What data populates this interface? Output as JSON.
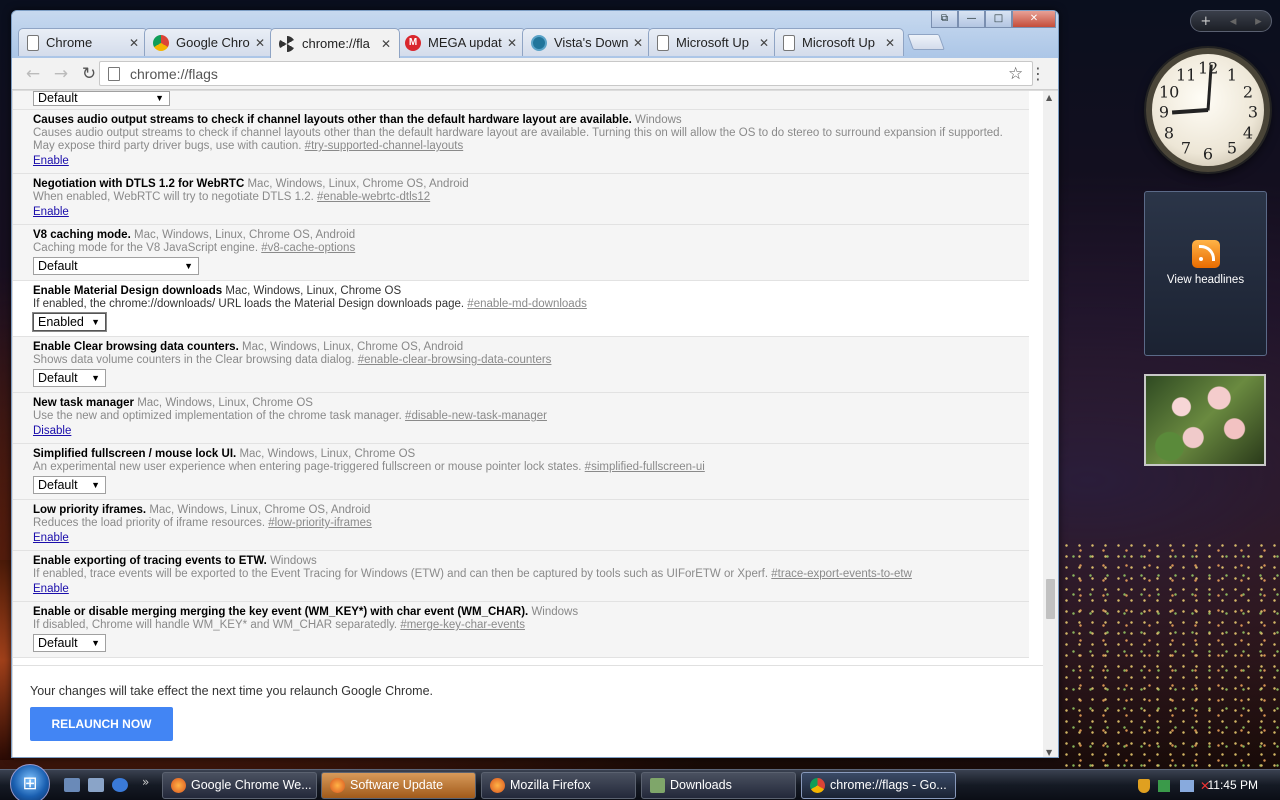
{
  "window": {
    "controls": [
      "⧉",
      "—",
      "□",
      "✕"
    ],
    "tabs": [
      {
        "title": "Chrome",
        "icon": "page-icon",
        "active": false
      },
      {
        "title": "Google Chro",
        "icon": "chrome-icon",
        "active": false
      },
      {
        "title": "chrome://fla",
        "icon": "radiation-icon",
        "active": true
      },
      {
        "title": "MEGA updat",
        "icon": "mega-icon",
        "active": false
      },
      {
        "title": "Vista's Down",
        "icon": "wordpress-icon",
        "active": false
      },
      {
        "title": "Microsoft Up",
        "icon": "page-icon",
        "active": false
      },
      {
        "title": "Microsoft Up",
        "icon": "page-icon",
        "active": false
      }
    ],
    "address": "chrome://flags"
  },
  "flags": [
    {
      "top_select": "Default"
    },
    {
      "name": "Causes audio output streams to check if channel layouts other than the default hardware layout are available.",
      "platforms": "Windows",
      "desc": "Causes audio output streams to check if channel layouts other than the default hardware layout are available. Turning this on will allow the OS to do stereo to surround expansion if supported. May expose third party driver bugs, use with caution.",
      "link": "#try-supported-channel-layouts",
      "action": "Enable"
    },
    {
      "name": "Negotiation with DTLS 1.2 for WebRTC",
      "platforms": "Mac, Windows, Linux, Chrome OS, Android",
      "desc": "When enabled, WebRTC will try to negotiate DTLS 1.2.",
      "link": "#enable-webrtc-dtls12",
      "action": "Enable"
    },
    {
      "name": "V8 caching mode.",
      "platforms": "Mac, Windows, Linux, Chrome OS, Android",
      "desc": "Caching mode for the V8 JavaScript engine.",
      "link": "#v8-cache-options",
      "select": "Default"
    },
    {
      "name": "Enable Material Design downloads",
      "platforms": "Mac, Windows, Linux, Chrome OS",
      "desc": "If enabled, the chrome://downloads/ URL loads the Material Design downloads page.",
      "link": "#enable-md-downloads",
      "select": "Enabled"
    },
    {
      "name": "Enable Clear browsing data counters.",
      "platforms": "Mac, Windows, Linux, Chrome OS, Android",
      "desc": "Shows data volume counters in the Clear browsing data dialog.",
      "link": "#enable-clear-browsing-data-counters",
      "select": "Default"
    },
    {
      "name": "New task manager",
      "platforms": "Mac, Windows, Linux, Chrome OS",
      "desc": "Use the new and optimized implementation of the chrome task manager.",
      "link": "#disable-new-task-manager",
      "action": "Disable"
    },
    {
      "name": "Simplified fullscreen / mouse lock UI.",
      "platforms": "Mac, Windows, Linux, Chrome OS",
      "desc": "An experimental new user experience when entering page-triggered fullscreen or mouse pointer lock states.",
      "link": "#simplified-fullscreen-ui",
      "select": "Default"
    },
    {
      "name": "Low priority iframes.",
      "platforms": "Mac, Windows, Linux, Chrome OS, Android",
      "desc": "Reduces the load priority of iframe resources.",
      "link": "#low-priority-iframes",
      "action": "Enable"
    },
    {
      "name": "Enable exporting of tracing events to ETW.",
      "platforms": "Windows",
      "desc": "If enabled, trace events will be exported to the Event Tracing for Windows (ETW) and can then be captured by tools such as UIForETW or Xperf.",
      "link": "#trace-export-events-to-etw",
      "action": "Enable"
    },
    {
      "name": "Enable or disable merging merging the key event (WM_KEY*) with char event (WM_CHAR).",
      "platforms": "Windows",
      "desc": "If disabled, Chrome will handle WM_KEY* and WM_CHAR separatedly.",
      "link": "#merge-key-char-events",
      "select": "Default"
    }
  ],
  "footer": {
    "message": "Your changes will take effect the next time you relaunch Google Chrome.",
    "button": "RELAUNCH NOW"
  },
  "gadgets": {
    "clock_numbers": [
      "12",
      "1",
      "2",
      "3",
      "4",
      "5",
      "6",
      "7",
      "8",
      "9",
      "10",
      "11"
    ],
    "headlines_label": "View headlines"
  },
  "taskbar": {
    "tasks": [
      {
        "label": "Google Chrome We...",
        "icon": "firefox-icon"
      },
      {
        "label": "Software Update",
        "icon": "firefox-icon"
      },
      {
        "label": "Mozilla Firefox",
        "icon": "firefox-icon"
      },
      {
        "label": "Downloads",
        "icon": "folder-icon"
      },
      {
        "label": "chrome://flags - Go...",
        "icon": "chrome-icon"
      }
    ],
    "time": "11:45 PM"
  },
  "colors": {
    "accent": "#4285f4",
    "link": "#1a0dab",
    "highlight_task": "#c27a34"
  }
}
